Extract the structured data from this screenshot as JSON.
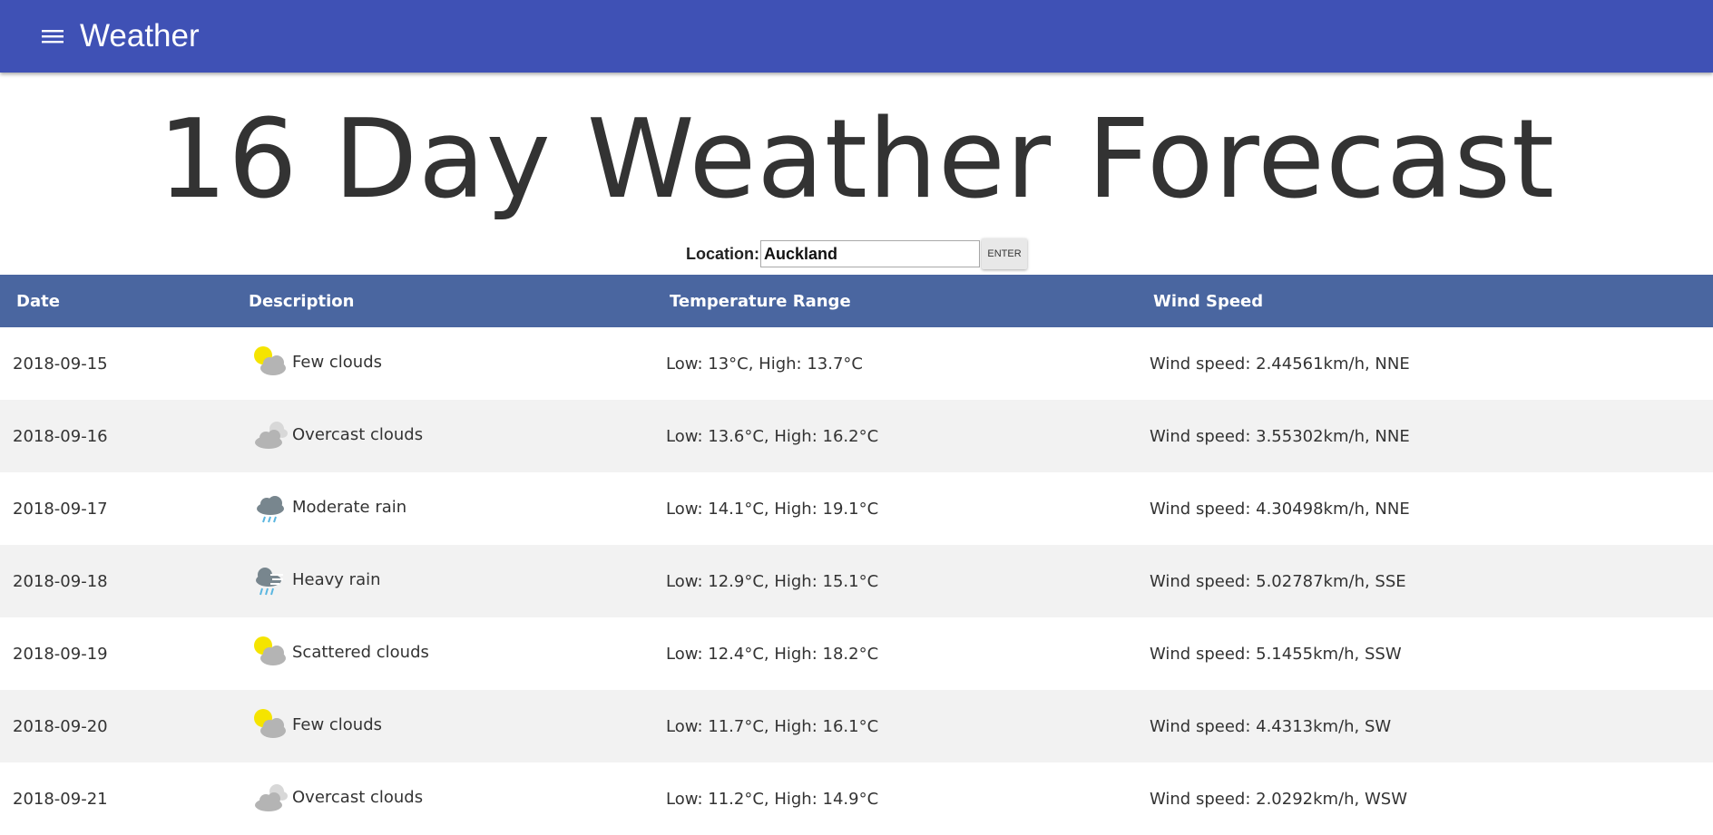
{
  "appbar": {
    "title": "Weather"
  },
  "page": {
    "title": "16 Day Weather Forecast"
  },
  "location": {
    "label": "Location:",
    "value": "Auckland",
    "button_label": "ENTER"
  },
  "table": {
    "headers": {
      "date": "Date",
      "description": "Description",
      "temperature": "Temperature Range",
      "wind": "Wind Speed"
    },
    "rows": [
      {
        "date": "2018-09-15",
        "icon": "few-clouds-icon",
        "description": "Few clouds",
        "temperature": "Low: 13°C, High: 13.7°C",
        "wind": "Wind speed: 2.44561km/h, NNE"
      },
      {
        "date": "2018-09-16",
        "icon": "overcast-clouds-icon",
        "description": "Overcast clouds",
        "temperature": "Low: 13.6°C, High: 16.2°C",
        "wind": "Wind speed: 3.55302km/h, NNE"
      },
      {
        "date": "2018-09-17",
        "icon": "moderate-rain-icon",
        "description": "Moderate rain",
        "temperature": "Low: 14.1°C, High: 19.1°C",
        "wind": "Wind speed: 4.30498km/h, NNE"
      },
      {
        "date": "2018-09-18",
        "icon": "heavy-rain-icon",
        "description": "Heavy rain",
        "temperature": "Low: 12.9°C, High: 15.1°C",
        "wind": "Wind speed: 5.02787km/h, SSE"
      },
      {
        "date": "2018-09-19",
        "icon": "scattered-clouds-icon",
        "description": "Scattered clouds",
        "temperature": "Low: 12.4°C, High: 18.2°C",
        "wind": "Wind speed: 5.1455km/h, SSW"
      },
      {
        "date": "2018-09-20",
        "icon": "few-clouds-icon",
        "description": "Few clouds",
        "temperature": "Low: 11.7°C, High: 16.1°C",
        "wind": "Wind speed: 4.4313km/h, SW"
      },
      {
        "date": "2018-09-21",
        "icon": "overcast-clouds-icon",
        "description": "Overcast clouds",
        "temperature": "Low: 11.2°C, High: 14.9°C",
        "wind": "Wind speed: 2.0292km/h, WSW"
      }
    ]
  },
  "colors": {
    "appbar": "#3f51b5",
    "table_header": "#4a66a0",
    "row_alt": "#f2f2f2"
  }
}
